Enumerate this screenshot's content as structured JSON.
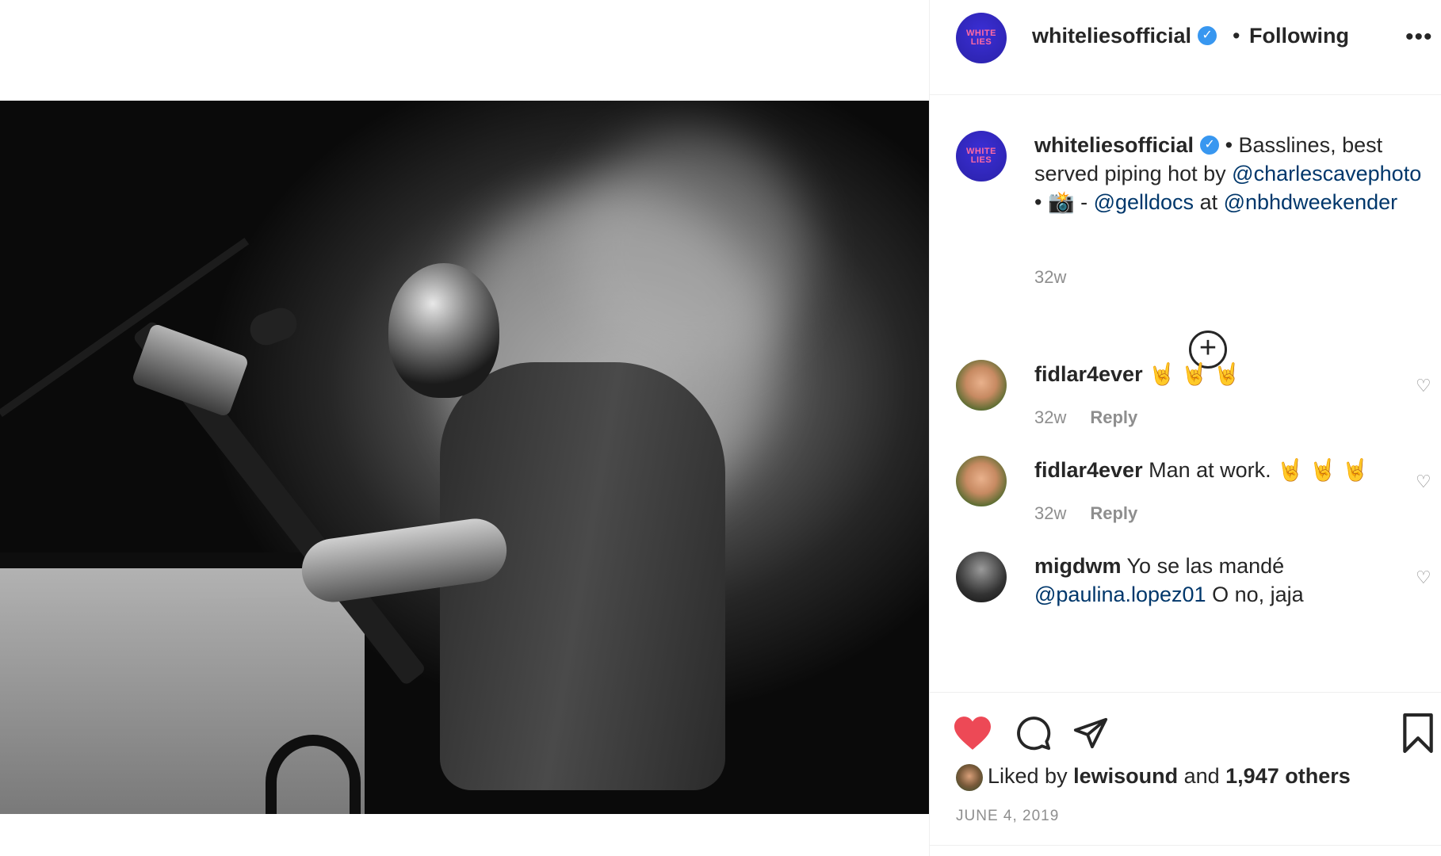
{
  "post": {
    "username": "whiteliesofficial",
    "verified_mark": "✓",
    "brand_avatar_text": "WHITE LIES",
    "separator": "•",
    "follow_status": "Following",
    "more_options": "•••"
  },
  "caption": {
    "username": "whiteliesofficial",
    "text_part1": " • Basslines, best served piping hot by ",
    "mention1": "@charlescavephoto",
    "text_part2": " • 📸 - ",
    "mention2": "@gelldocs",
    "text_part3": " at ",
    "mention3": "@nbhdweekender",
    "time": "32w"
  },
  "load_more_icon": "+",
  "comments": [
    {
      "username": "fidlar4ever",
      "text": " 🤘 🤘 🤘",
      "time": "32w",
      "reply": "Reply"
    },
    {
      "username": "fidlar4ever",
      "text": " Man at work. 🤘 🤘 🤘",
      "time": "32w",
      "reply": "Reply"
    },
    {
      "username": "migdwm",
      "text": " Yo se las mandé",
      "mention": "@paulina.lopez01",
      "text2": " O no, jaja"
    }
  ],
  "likes": {
    "prefix": "Liked by ",
    "user": "lewisound",
    "middle": " and ",
    "count": "1,947 others"
  },
  "date": "JUNE 4, 2019",
  "icons": [
    "heart-filled-icon",
    "comment-icon",
    "share-icon",
    "bookmark-icon"
  ],
  "colors": {
    "like_red": "#ed4956",
    "verified_blue": "#3897f0",
    "mention_blue": "#00376b",
    "muted": "#8e8e8e"
  }
}
